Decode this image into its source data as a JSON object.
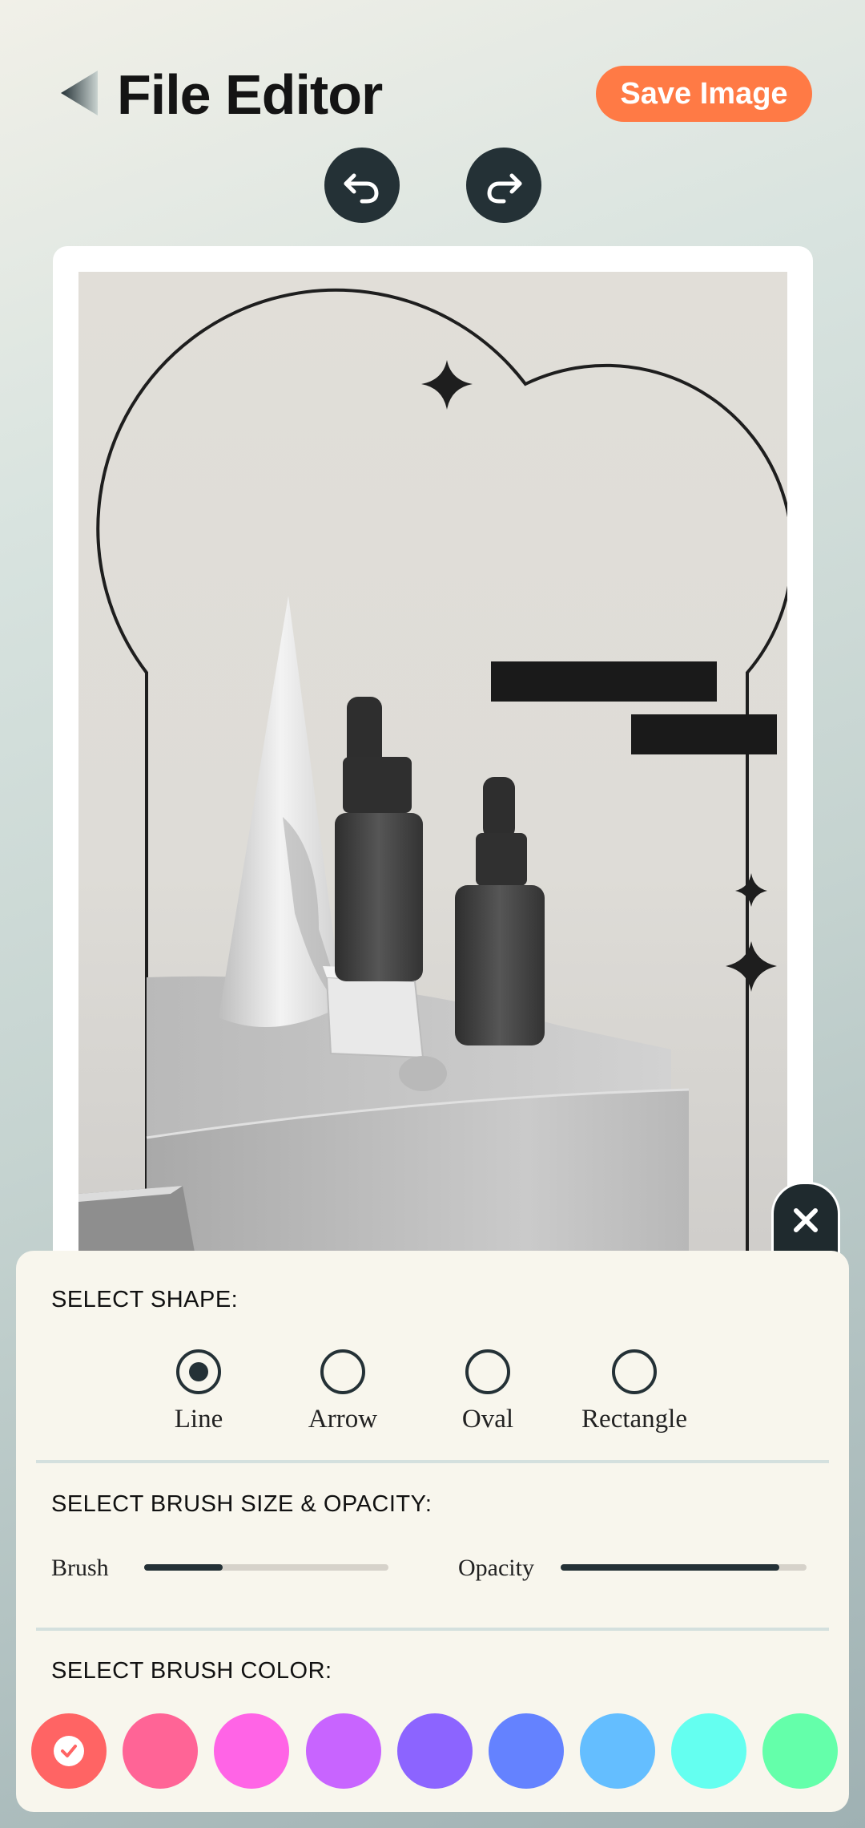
{
  "header": {
    "title": "File Editor",
    "save_label": "Save Image"
  },
  "toolbar": {
    "undo_icon": "undo-icon",
    "redo_icon": "redo-icon"
  },
  "shape_section": {
    "title": "SELECT SHAPE:",
    "options": [
      {
        "label": "Line",
        "selected": true
      },
      {
        "label": "Arrow",
        "selected": false
      },
      {
        "label": "Oval",
        "selected": false
      },
      {
        "label": "Rectangle",
        "selected": false
      }
    ]
  },
  "brush_section": {
    "title": "SELECT BRUSH SIZE & OPACITY:",
    "brush_label": "Brush",
    "brush_value": 0.32,
    "opacity_label": "Opacity",
    "opacity_value": 0.89
  },
  "color_section": {
    "title": "SELECT BRUSH COLOR:",
    "colors": [
      "#ff6464",
      "#ff6496",
      "#ff64e6",
      "#c864ff",
      "#8c64ff",
      "#6482ff",
      "#64beff",
      "#64fff0",
      "#64ffaa"
    ],
    "selected_index": 0
  },
  "colors": {
    "accent": "#ff7a45",
    "dark": "#243136"
  }
}
